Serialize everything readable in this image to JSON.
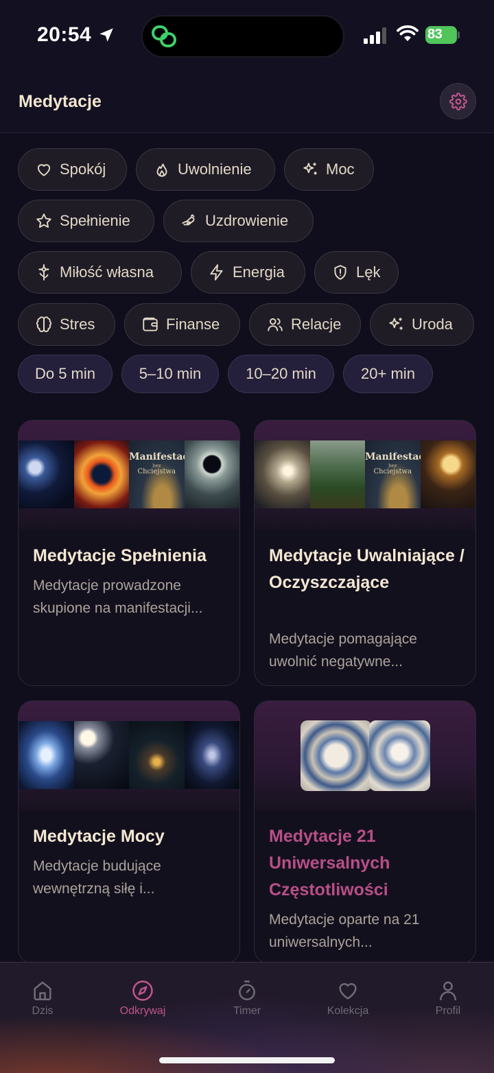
{
  "status_bar": {
    "time": "20:54",
    "battery": "83"
  },
  "header": {
    "title": "Medytacje"
  },
  "topic_filters": [
    {
      "label": "Spokój",
      "icon": "heart-icon"
    },
    {
      "label": "Uwolnienie",
      "icon": "flame-icon"
    },
    {
      "label": "Moc",
      "icon": "sparkles-icon"
    },
    {
      "label": "Spełnienie",
      "icon": "star-icon"
    },
    {
      "label": "Uzdrowienie",
      "icon": "healing-hand-icon"
    },
    {
      "label": "Miłość własna",
      "icon": "flower-icon"
    },
    {
      "label": "Energia",
      "icon": "zap-icon"
    },
    {
      "label": "Lęk",
      "icon": "shield-alert-icon"
    },
    {
      "label": "Stres",
      "icon": "brain-icon"
    },
    {
      "label": "Finanse",
      "icon": "wallet-icon"
    },
    {
      "label": "Relacje",
      "icon": "users-icon"
    },
    {
      "label": "Uroda",
      "icon": "sparkles-icon"
    }
  ],
  "duration_filters": [
    "Do 5 min",
    "5–10 min",
    "10–20 min",
    "20+ min"
  ],
  "cards": [
    {
      "title": "Medytacje Spełnienia",
      "description": "Medytacje prowadzone skupione na manifestacji...",
      "thumbnail_text": [
        "Manifestacja",
        "bez",
        "Chciejstwa"
      ]
    },
    {
      "title": "Medytacje Uwalniające / Oczyszczające",
      "description": "Medytacje pomagające uwolnić negatywne...",
      "thumbnail_text": [
        "Manifestacja",
        "bez",
        "Chciejstwa"
      ]
    },
    {
      "title": "Medytacje Mocy",
      "description": "Medytacje budujące wewnętrzną siłę i..."
    },
    {
      "title": "Medytacje 21 Uniwersalnych Częstotliwości",
      "description": "Medytacje oparte na 21 uniwersalnych..."
    }
  ],
  "tabs": [
    {
      "label": "Dzis",
      "icon": "home-icon"
    },
    {
      "label": "Odkrywaj",
      "icon": "compass-icon",
      "active": true
    },
    {
      "label": "Timer",
      "icon": "stopwatch-icon"
    },
    {
      "label": "Kolekcja",
      "icon": "heart-icon"
    },
    {
      "label": "Profil",
      "icon": "user-icon"
    }
  ],
  "colors": {
    "accent": "#c0548e",
    "background": "#100d1c",
    "chip": "#1f1c26",
    "duration_chip": "#241f3a"
  }
}
